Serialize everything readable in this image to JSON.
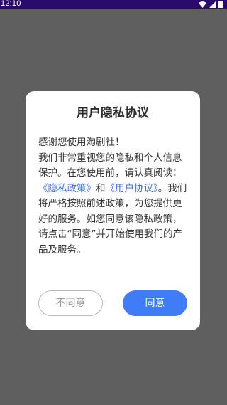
{
  "status_bar": {
    "time": "12:10",
    "icons": [
      "wifi-icon",
      "signal-icon",
      "battery-icon"
    ]
  },
  "dialog": {
    "title": "用户隐私协议",
    "greeting": "感谢您使用淘剧社！",
    "text_1": "我们非常重视您的隐私和个人信息保护。在您使用前，请认真阅读：",
    "privacy_link": "《隐私政策》",
    "and": "和",
    "user_agreement_link": "《用户协议》",
    "text_2": "。我们将严格按照前述政策，为您提供更好的服务。如您同意该隐私政策，请点击“同意”并开始使用我们的产品及服务。",
    "disagree_label": "不同意",
    "agree_label": "同意"
  },
  "colors": {
    "overlay": "#5f5f5f",
    "status_bar": "#2a0a6b",
    "link": "#3b6fe0",
    "primary": "#3f7cf5"
  }
}
